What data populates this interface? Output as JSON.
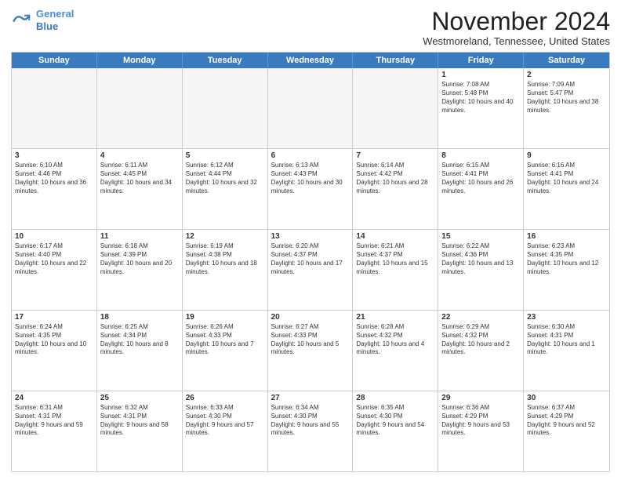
{
  "header": {
    "logo_line1": "General",
    "logo_line2": "Blue",
    "month": "November 2024",
    "location": "Westmoreland, Tennessee, United States"
  },
  "weekdays": [
    "Sunday",
    "Monday",
    "Tuesday",
    "Wednesday",
    "Thursday",
    "Friday",
    "Saturday"
  ],
  "rows": [
    [
      {
        "day": "",
        "info": ""
      },
      {
        "day": "",
        "info": ""
      },
      {
        "day": "",
        "info": ""
      },
      {
        "day": "",
        "info": ""
      },
      {
        "day": "",
        "info": ""
      },
      {
        "day": "1",
        "info": "Sunrise: 7:08 AM\nSunset: 5:48 PM\nDaylight: 10 hours and 40 minutes."
      },
      {
        "day": "2",
        "info": "Sunrise: 7:09 AM\nSunset: 5:47 PM\nDaylight: 10 hours and 38 minutes."
      }
    ],
    [
      {
        "day": "3",
        "info": "Sunrise: 6:10 AM\nSunset: 4:46 PM\nDaylight: 10 hours and 36 minutes."
      },
      {
        "day": "4",
        "info": "Sunrise: 6:11 AM\nSunset: 4:45 PM\nDaylight: 10 hours and 34 minutes."
      },
      {
        "day": "5",
        "info": "Sunrise: 6:12 AM\nSunset: 4:44 PM\nDaylight: 10 hours and 32 minutes."
      },
      {
        "day": "6",
        "info": "Sunrise: 6:13 AM\nSunset: 4:43 PM\nDaylight: 10 hours and 30 minutes."
      },
      {
        "day": "7",
        "info": "Sunrise: 6:14 AM\nSunset: 4:42 PM\nDaylight: 10 hours and 28 minutes."
      },
      {
        "day": "8",
        "info": "Sunrise: 6:15 AM\nSunset: 4:41 PM\nDaylight: 10 hours and 26 minutes."
      },
      {
        "day": "9",
        "info": "Sunrise: 6:16 AM\nSunset: 4:41 PM\nDaylight: 10 hours and 24 minutes."
      }
    ],
    [
      {
        "day": "10",
        "info": "Sunrise: 6:17 AM\nSunset: 4:40 PM\nDaylight: 10 hours and 22 minutes."
      },
      {
        "day": "11",
        "info": "Sunrise: 6:18 AM\nSunset: 4:39 PM\nDaylight: 10 hours and 20 minutes."
      },
      {
        "day": "12",
        "info": "Sunrise: 6:19 AM\nSunset: 4:38 PM\nDaylight: 10 hours and 18 minutes."
      },
      {
        "day": "13",
        "info": "Sunrise: 6:20 AM\nSunset: 4:37 PM\nDaylight: 10 hours and 17 minutes."
      },
      {
        "day": "14",
        "info": "Sunrise: 6:21 AM\nSunset: 4:37 PM\nDaylight: 10 hours and 15 minutes."
      },
      {
        "day": "15",
        "info": "Sunrise: 6:22 AM\nSunset: 4:36 PM\nDaylight: 10 hours and 13 minutes."
      },
      {
        "day": "16",
        "info": "Sunrise: 6:23 AM\nSunset: 4:35 PM\nDaylight: 10 hours and 12 minutes."
      }
    ],
    [
      {
        "day": "17",
        "info": "Sunrise: 6:24 AM\nSunset: 4:35 PM\nDaylight: 10 hours and 10 minutes."
      },
      {
        "day": "18",
        "info": "Sunrise: 6:25 AM\nSunset: 4:34 PM\nDaylight: 10 hours and 8 minutes."
      },
      {
        "day": "19",
        "info": "Sunrise: 6:26 AM\nSunset: 4:33 PM\nDaylight: 10 hours and 7 minutes."
      },
      {
        "day": "20",
        "info": "Sunrise: 6:27 AM\nSunset: 4:33 PM\nDaylight: 10 hours and 5 minutes."
      },
      {
        "day": "21",
        "info": "Sunrise: 6:28 AM\nSunset: 4:32 PM\nDaylight: 10 hours and 4 minutes."
      },
      {
        "day": "22",
        "info": "Sunrise: 6:29 AM\nSunset: 4:32 PM\nDaylight: 10 hours and 2 minutes."
      },
      {
        "day": "23",
        "info": "Sunrise: 6:30 AM\nSunset: 4:31 PM\nDaylight: 10 hours and 1 minute."
      }
    ],
    [
      {
        "day": "24",
        "info": "Sunrise: 6:31 AM\nSunset: 4:31 PM\nDaylight: 9 hours and 59 minutes."
      },
      {
        "day": "25",
        "info": "Sunrise: 6:32 AM\nSunset: 4:31 PM\nDaylight: 9 hours and 58 minutes."
      },
      {
        "day": "26",
        "info": "Sunrise: 6:33 AM\nSunset: 4:30 PM\nDaylight: 9 hours and 57 minutes."
      },
      {
        "day": "27",
        "info": "Sunrise: 6:34 AM\nSunset: 4:30 PM\nDaylight: 9 hours and 55 minutes."
      },
      {
        "day": "28",
        "info": "Sunrise: 6:35 AM\nSunset: 4:30 PM\nDaylight: 9 hours and 54 minutes."
      },
      {
        "day": "29",
        "info": "Sunrise: 6:36 AM\nSunset: 4:29 PM\nDaylight: 9 hours and 53 minutes."
      },
      {
        "day": "30",
        "info": "Sunrise: 6:37 AM\nSunset: 4:29 PM\nDaylight: 9 hours and 52 minutes."
      }
    ]
  ]
}
